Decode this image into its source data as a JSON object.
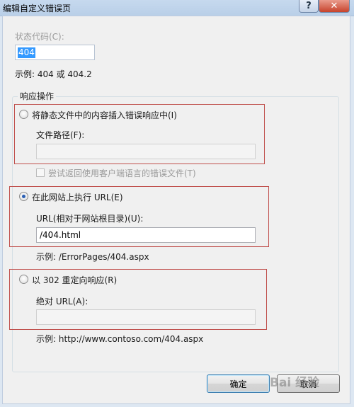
{
  "window": {
    "title": "编辑自定义错误页",
    "help_label": "?",
    "close_label": "✕"
  },
  "status_code": {
    "label": "状态代码(C):",
    "value": "404",
    "example": "示例: 404 或 404.2"
  },
  "response_group": {
    "caption": "响应操作",
    "option_static": {
      "label": "将静态文件中的内容插入错误响应中(I)",
      "path_label": "文件路径(F):",
      "path_value": "",
      "try_lang_label": "尝试返回使用客户端语言的错误文件(T)"
    },
    "option_execute": {
      "label": "在此网站上执行 URL(E)",
      "url_label": "URL(相对于网站根目录)(U):",
      "url_value": "/404.html",
      "example": "示例: /ErrorPages/404.aspx"
    },
    "option_redirect": {
      "label": "以 302 重定向响应(R)",
      "url_label": "绝对 URL(A):",
      "url_value": "",
      "example": "示例: http://www.contoso.com/404.aspx"
    }
  },
  "buttons": {
    "ok_label": "确定",
    "cancel_label": "取消"
  },
  "watermark": {
    "text": "Bai 经验"
  },
  "colors": {
    "highlight_box": "#c0504d",
    "selection": "#3399ff"
  }
}
